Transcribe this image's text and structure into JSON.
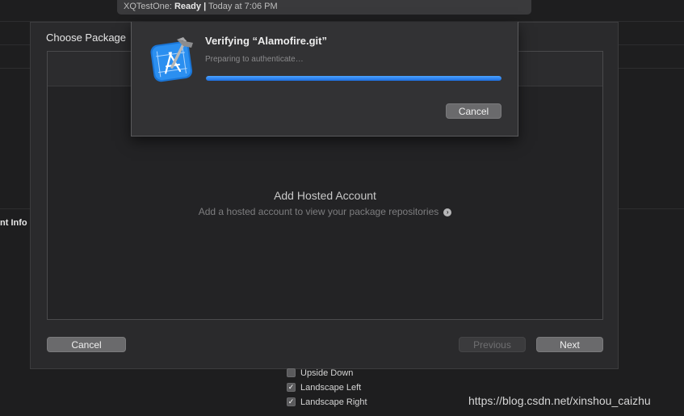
{
  "activity": {
    "project": "XQTestOne:",
    "status": "Ready",
    "separator": "|",
    "time": "Today at 7:06 PM"
  },
  "background": {
    "section_label": "nt Info"
  },
  "sheet": {
    "title": "Choose Package",
    "empty_title": "Add Hosted Account",
    "empty_subtitle": "Add a hosted account to view your package repositories",
    "cancel_label": "Cancel",
    "previous_label": "Previous",
    "next_label": "Next",
    "arrow_icon": "arrow-right-circle-icon"
  },
  "dialog": {
    "title": "Verifying “Alamofire.git”",
    "message": "Preparing to authenticate…",
    "progress": 1.0,
    "cancel_label": "Cancel",
    "icon": "xcode-app-icon"
  },
  "orientation_options": [
    {
      "label": "Upside Down",
      "checked": false
    },
    {
      "label": "Landscape Left",
      "checked": true
    },
    {
      "label": "Landscape Right",
      "checked": true
    }
  ],
  "watermark": "https://blog.csdn.net/xinshou_caizhu"
}
